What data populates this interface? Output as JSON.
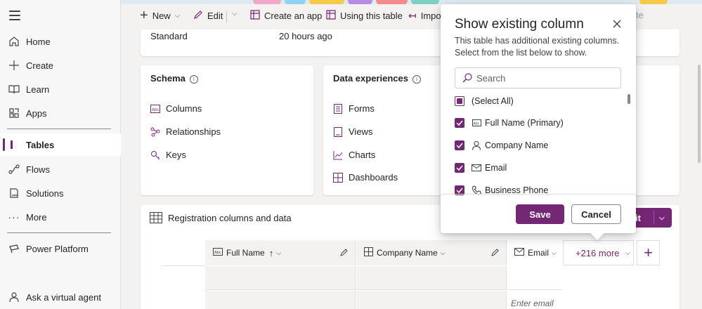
{
  "sidebar": {
    "items": [
      {
        "label": "Home",
        "icon": "home-icon"
      },
      {
        "label": "Create",
        "icon": "plus-icon"
      },
      {
        "label": "Learn",
        "icon": "book-icon"
      },
      {
        "label": "Apps",
        "icon": "apps-icon"
      },
      {
        "label": "Tables",
        "icon": "tables-icon",
        "active": true
      },
      {
        "label": "Flows",
        "icon": "flow-icon"
      },
      {
        "label": "Solutions",
        "icon": "solutions-icon"
      },
      {
        "label": "More",
        "icon": "more-icon"
      },
      {
        "label": "Power Platform",
        "icon": "power-platform-icon"
      },
      {
        "label": "Ask a virtual agent",
        "icon": "agent-icon"
      }
    ]
  },
  "commandbar": {
    "new_label": "New",
    "edit_label": "Edit",
    "create_app_label": "Create an app",
    "using_table_label": "Using this table",
    "import_label": "Impo",
    "trailing_label": "te"
  },
  "properties": {
    "type_value": "Standard",
    "modified_value": "20 hours ago"
  },
  "schema": {
    "title": "Schema",
    "items": [
      "Columns",
      "Relationships",
      "Keys"
    ]
  },
  "data_experiences": {
    "title": "Data experiences",
    "items": [
      "Forms",
      "Views",
      "Charts",
      "Dashboards"
    ]
  },
  "data_section": {
    "title": "Registration columns and data",
    "edit_fragment": "it",
    "columns": [
      {
        "label": "Full Name",
        "sort": "↑"
      },
      {
        "label": "Company Name"
      },
      {
        "label": "Email"
      }
    ],
    "more_label": "+216 more",
    "email_placeholder": "Enter email"
  },
  "popup": {
    "title": "Show existing column",
    "description": "This table has additional existing columns. Select from the list below to show.",
    "search_placeholder": "Search",
    "options": [
      {
        "label": "(Select All)",
        "state": "partial"
      },
      {
        "label": "Full Name (Primary)",
        "icon": "text-field-icon",
        "state": "checked"
      },
      {
        "label": "Company Name",
        "icon": "person-icon",
        "state": "checked"
      },
      {
        "label": "Email",
        "icon": "mail-icon",
        "state": "checked"
      },
      {
        "label": "Business Phone",
        "icon": "phone-icon",
        "state": "checked"
      }
    ],
    "save_label": "Save",
    "cancel_label": "Cancel"
  },
  "colors": {
    "accent": "#742774",
    "background": "#f3f2f1",
    "card": "#ffffff"
  }
}
